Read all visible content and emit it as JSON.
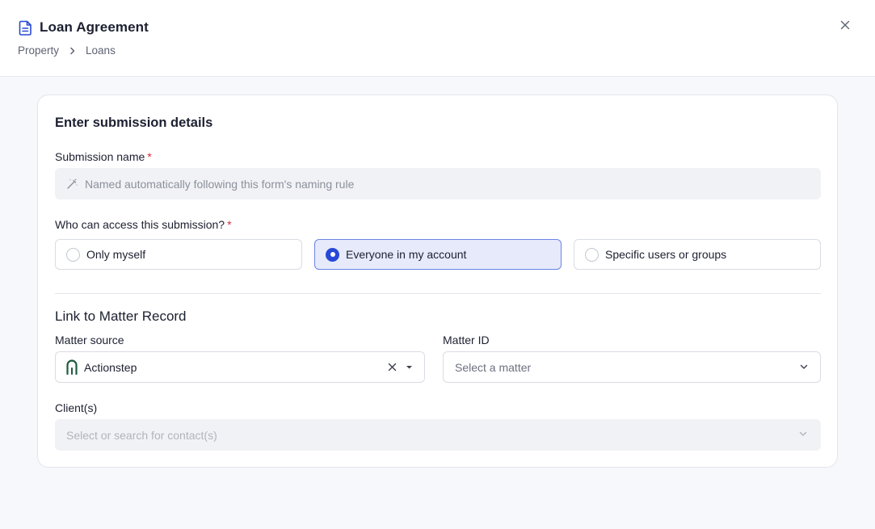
{
  "header": {
    "title": "Loan Agreement",
    "breadcrumb": [
      "Property",
      "Loans"
    ],
    "icon": "document-icon",
    "close_icon": "close-icon"
  },
  "form": {
    "section_title": "Enter submission details",
    "submission_name": {
      "label": "Submission name",
      "required_mark": "*",
      "placeholder": "Named automatically following this form's naming rule",
      "icon": "magic-wand-icon"
    },
    "access": {
      "label": "Who can access this submission?",
      "required_mark": "*",
      "options": [
        {
          "label": "Only myself",
          "selected": false
        },
        {
          "label": "Everyone in my account",
          "selected": true
        },
        {
          "label": "Specific users or groups",
          "selected": false
        }
      ]
    },
    "matter_section_title": "Link to Matter Record",
    "matter_source": {
      "label": "Matter source",
      "value": "Actionstep",
      "icon": "actionstep-logo-icon"
    },
    "matter_id": {
      "label": "Matter ID",
      "placeholder": "Select a matter"
    },
    "clients": {
      "label": "Client(s)",
      "placeholder": "Select or search for contact(s)"
    }
  },
  "colors": {
    "accent": "#2749d6",
    "selected_bg": "#e6eafb",
    "required": "#d42b3a",
    "brand_actionstep": "#1d5c3f"
  }
}
